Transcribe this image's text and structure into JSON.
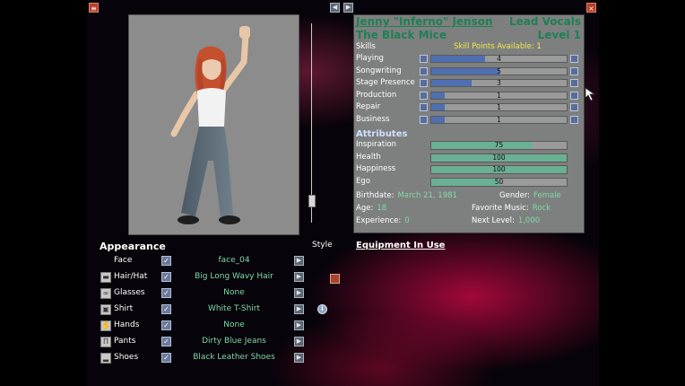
{
  "character": {
    "name": "Jenny \"Inferno\" Jenson",
    "role": "Lead Vocals",
    "band": "The Black Mice",
    "level": "Level 1"
  },
  "skills": {
    "label": "Skills",
    "points_text": "Skill Points Available: 1",
    "max": 10,
    "items": [
      {
        "name": "Playing",
        "value": "4"
      },
      {
        "name": "Songwriting",
        "value": "5"
      },
      {
        "name": "Stage Presence",
        "value": "3"
      },
      {
        "name": "Production",
        "value": "1"
      },
      {
        "name": "Repair",
        "value": "1"
      },
      {
        "name": "Business",
        "value": "1"
      }
    ]
  },
  "attributes": {
    "label": "Attributes",
    "max": 100,
    "items": [
      {
        "name": "Inspiration",
        "value": "75"
      },
      {
        "name": "Health",
        "value": "100"
      },
      {
        "name": "Happiness",
        "value": "100"
      },
      {
        "name": "Ego",
        "value": "50"
      }
    ]
  },
  "details": {
    "birthdate_label": "Birthdate:",
    "birthdate": "March 21, 1981",
    "gender_label": "Gender:",
    "gender": "Female",
    "age_label": "Age:",
    "age": "18",
    "music_label": "Favorite Music:",
    "music": "Rock",
    "experience_label": "Experience:",
    "experience": "0",
    "next_level_label": "Next Level:",
    "next_level": "1,000"
  },
  "appearance": {
    "title": "Appearance",
    "style_label": "Style",
    "rows": [
      {
        "label": "Face",
        "value": "face_04",
        "icon": "face-icon"
      },
      {
        "label": "Hair/Hat",
        "value": "Big Long Wavy Hair",
        "icon": "hat-icon"
      },
      {
        "label": "Glasses",
        "value": "None",
        "icon": "glasses-icon"
      },
      {
        "label": "Shirt",
        "value": "White T-Shirt",
        "icon": "shirt-icon"
      },
      {
        "label": "Hands",
        "value": "None",
        "icon": "hands-icon"
      },
      {
        "label": "Pants",
        "value": "Dirty Blue Jeans",
        "icon": "pants-icon"
      },
      {
        "label": "Shoes",
        "value": "Black Leather Shoes",
        "icon": "shoes-icon"
      }
    ]
  },
  "equipment": {
    "title": "Equipment In Use"
  },
  "zoom_level": 0.08,
  "colors": {
    "panel_heading": "#1f7f55",
    "value_green": "#7fd9a7",
    "skill_points_yellow": "#f1e64a",
    "skill_bar_fill": "#4f6fb0",
    "attribute_bar_fill": "#6ab093"
  }
}
